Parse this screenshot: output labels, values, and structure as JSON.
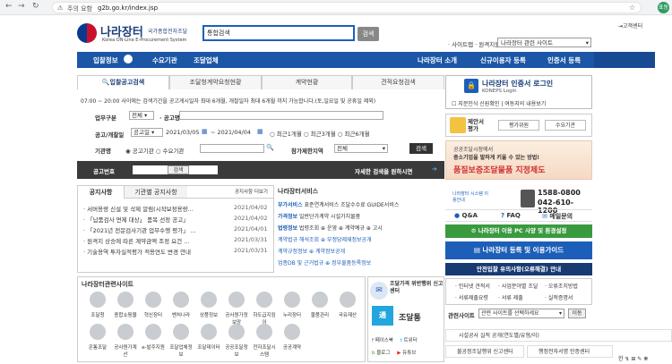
{
  "browser": {
    "url_warning": "주의 요함",
    "url": "g2b.go.kr/index.jsp",
    "profile_initials": "표동"
  },
  "header": {
    "logo_title": "나라장터",
    "logo_sub": "국가종합전자조달",
    "logo_en": "Korea ON-Line E-Procurement System",
    "search_scope": "통합검색",
    "search_button": "검색",
    "customer_center": "⇥고객센터",
    "links": [
      "사이트맵",
      "원격지원"
    ],
    "related_sites": "나라장터 관련 사이트"
  },
  "nav": {
    "items": [
      "입찰정보",
      "수요기관",
      "조달업체",
      "나라장터 소개",
      "신규이용자 등록",
      "인증서 등록"
    ]
  },
  "search_panel": {
    "tabs": [
      "입찰공고검색",
      "조달청계약요청현황",
      "계약현황",
      "견적요청검색"
    ],
    "notice": "07:00 ~ 20:00 사이에는 검색기간을 공고게시일자 최대 6개월, 개찰일자 최대 6개월 까지 가능합니다.(토,일요일 및 공휴일 제외)",
    "work_type_label": "업무구분",
    "work_type_value": "전체",
    "notice_name_label": "공고명",
    "period_label": "공고/개찰일",
    "period_type": "공고일",
    "date_from": "2021/03/05",
    "date_to": "2021/04/04",
    "range_options": [
      "최근1개월",
      "최근3개월",
      "최근6개월"
    ],
    "agency_label": "기관명",
    "agency_options": [
      "공고기관",
      "수요기관"
    ],
    "region_label": "참가제한지역",
    "region_value": "전체",
    "search_button": "검색",
    "notice_no_label": "공고번호",
    "notice_no_button": "검색",
    "detail_link": "자세한 검색을 원하시면"
  },
  "notices": {
    "tabs": [
      "공지사항",
      "기관별 공지사항"
    ],
    "more": "공지사항 더보기",
    "items": [
      {
        "title": "· 서버용량 신설 및 삭제 알림(시작보정용량...",
        "date": "2021/04/02"
      },
      {
        "title": "· 「납품검사 면제 대상」 품목 선정 공고」",
        "date": "2021/04/02"
      },
      {
        "title": "· 「2021년 전문검사기관 업무수행 평가」 ...",
        "date": "2021/04/01"
      },
      {
        "title": "· 원격지 상승에 따른 계약금액 조정 요건 ...",
        "date": "2021/03/31"
      },
      {
        "title": "· 기술용역 투자실적평가 적용연도 변경 안내",
        "date": "2021/03/31"
      }
    ]
  },
  "services": {
    "title": "나라장터서비스",
    "rows": [
      {
        "label": "부가서비스",
        "text": "표준연계서비스 조달수수료 GUIDE서비스"
      },
      {
        "label": "가격정보",
        "text": "일반단가계약 시설가치물품"
      },
      {
        "label": "법령정보",
        "text": "법령조회 ⊕ 운영 ⊕ 계약예규 ⊕ 고시"
      },
      {
        "label": "계약법규 해석조회",
        "text": "부정당제재정보공개"
      },
      {
        "label": "계약규정정보",
        "text": "계약정보공개"
      },
      {
        "label": "업종DB 및 근거법규",
        "text": "정부물품등록정보"
      }
    ]
  },
  "related": {
    "title": "나라장터관련사이트",
    "row1": [
      "조달청",
      "종합쇼핑몰",
      "혁신장터",
      "벤처나라",
      "상품정보",
      "공사원가정보망",
      "하도급지킴이",
      "누리장터",
      "물품관리",
      "국유재산"
    ],
    "row2": [
      "온통조달",
      "공사원가계산",
      "e-발주지원",
      "조달업체정보",
      "조달데이터",
      "공공조달정보",
      "전자조달시스템",
      "공공계약"
    ]
  },
  "promo": {
    "report_center": "조달가격 위반행위 신고센터",
    "app_name": "조달통",
    "social": [
      "페이스북",
      "트위터",
      "블로그",
      "유튜브"
    ]
  },
  "right": {
    "login_title": "나라장터 인증서 로그인",
    "login_sub": "KONEPS Login",
    "option1": "지문인식 신원확인",
    "option2": "여동지의 내용보기",
    "eval_title": "제안서 평가",
    "eval_btn1": "평가위원",
    "eval_btn2": "수요기관",
    "banner_line1": "공공조달시장에서",
    "banner_line2": "중소기업을 발하게 키울 수 있는 방법!",
    "banner_big": "품질보증조달물품 지정제도",
    "callcenter_label": "나라장터 시스템 이용안내",
    "phone1": "1588-0800",
    "phone2": "042-610-1200",
    "help": [
      "Q&A",
      "FAQ",
      "메일문의"
    ],
    "guide_green": "나라장터 이용 PC 사양 및 환경설정",
    "guide_blue": "나라장터 등록 및 이용가이드",
    "alert": "안전입찰 유의사항(오류해결) 안내",
    "quick_links": [
      "인터넷 견적서",
      "사업분야별 조달",
      "오류조치방법",
      "서류제출요령",
      "서류 제출",
      "실적증명서"
    ],
    "related_label": "관련사이트",
    "related_select": "관련 사이트를 선택하세요",
    "go": "이동",
    "bottom1": "시설공사 실적 공개(연도별/유형/이)",
    "bottom2": "불공정조달행위 신고센터",
    "bottom3": "행정전자서명 인증센터"
  }
}
